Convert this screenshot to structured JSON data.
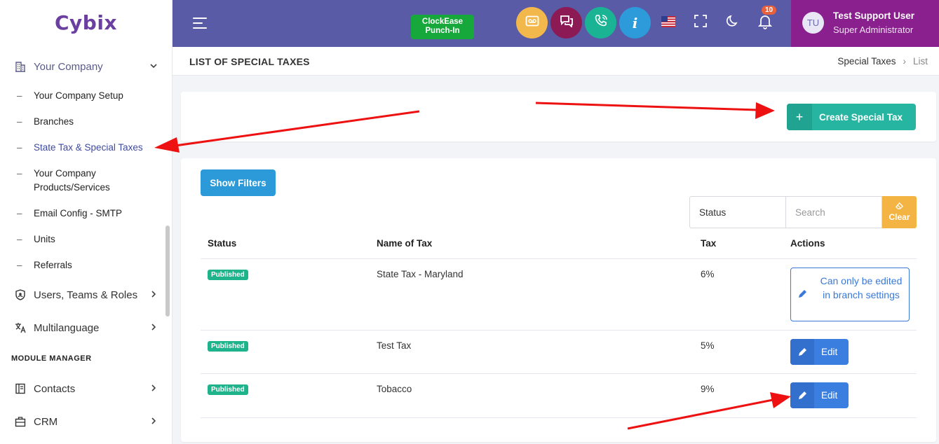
{
  "app": {
    "logo": "Cybix"
  },
  "sidebar": {
    "company": {
      "label": "Your Company",
      "icon": "building-icon"
    },
    "sub_items": [
      {
        "label": "Your Company Setup"
      },
      {
        "label": "Branches"
      },
      {
        "label": "State Tax & Special Taxes",
        "active": true
      },
      {
        "label": "Your Company Products/Services"
      },
      {
        "label": "Email Config - SMTP"
      },
      {
        "label": "Units"
      },
      {
        "label": "Referrals"
      }
    ],
    "items": [
      {
        "label": "Users, Teams & Roles",
        "icon": "user-shield-icon"
      },
      {
        "label": "Multilanguage",
        "icon": "translate-icon"
      }
    ],
    "section_title": "MODULE MANAGER",
    "module_items": [
      {
        "label": "Contacts",
        "icon": "contacts-book-icon"
      },
      {
        "label": "CRM",
        "icon": "briefcase-icon"
      }
    ]
  },
  "topbar": {
    "clockease": "ClockEase Punch-In",
    "notification_count": "10",
    "user": {
      "initials": "TU",
      "name": "Test Support User",
      "role": "Super Administrator"
    },
    "colors": {
      "bar": "#5a5ba7",
      "user_bg": "#8a1f8e",
      "voicemail": "#f2b84b",
      "chat": "#8b1a55",
      "phone": "#1ab394",
      "info": "#2d9ad9"
    }
  },
  "page": {
    "title": "LIST OF SPECIAL TAXES",
    "breadcrumb": [
      "Special Taxes",
      "List"
    ]
  },
  "actions": {
    "create_label": "Create Special Tax",
    "filters_label": "Show Filters"
  },
  "filters": {
    "status_value": "Status",
    "search_placeholder": "Search",
    "clear_label": "Clear"
  },
  "table": {
    "headers": [
      "Status",
      "Name of Tax",
      "Tax",
      "Actions"
    ],
    "rows": [
      {
        "status": "Published",
        "name": "State Tax - Maryland",
        "tax": "6%",
        "action": "Can only be edited in branch settings"
      },
      {
        "status": "Published",
        "name": "Test Tax",
        "tax": "5%",
        "action": "Edit"
      },
      {
        "status": "Published",
        "name": "Tobacco",
        "tax": "9%",
        "action": "Edit"
      }
    ]
  }
}
